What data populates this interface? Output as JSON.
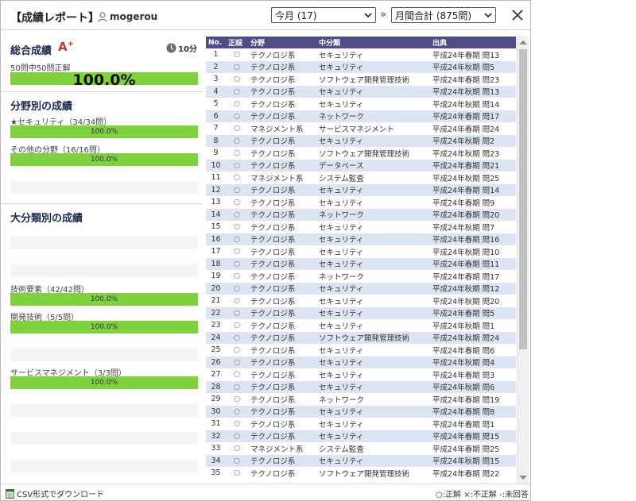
{
  "header": {
    "title": "【成績レポート】",
    "username": "mogerou",
    "period_select": "今月 (17)",
    "arrow": "»",
    "scope_select": "月間合計 (875問)"
  },
  "overall": {
    "title": "総合成績",
    "grade": "A",
    "grade_sup": "+",
    "time": "10分",
    "summary": "50問中50問正解",
    "percent": "100.0%"
  },
  "by_field": {
    "title": "分野別の成績",
    "items": [
      {
        "label": "★セキュリティ（34/34問）",
        "value": "100.0%"
      },
      {
        "label": "その他の分野（16/16問）",
        "value": "100.0%"
      }
    ]
  },
  "by_major": {
    "title": "大分類別の成績",
    "items": [
      {
        "label": "技術要素（42/42問）",
        "value": "100.0%"
      },
      {
        "label": "開発技術（5/5問）",
        "value": "100.0%"
      },
      {
        "label": "サービスマネジメント（3/3問）",
        "value": "100.0%"
      }
    ]
  },
  "table": {
    "headers": [
      "No.",
      "正誤",
      "分野",
      "中分類",
      "出典"
    ],
    "rows": [
      [
        "1",
        "○",
        "テクノロジ系",
        "セキュリティ",
        "平成24年春期 問13"
      ],
      [
        "2",
        "○",
        "テクノロジ系",
        "セキュリティ",
        "平成24年秋期 問5"
      ],
      [
        "3",
        "○",
        "テクノロジ系",
        "ソフトウェア開発管理技術",
        "平成24年春期 問23"
      ],
      [
        "4",
        "○",
        "テクノロジ系",
        "セキュリティ",
        "平成24年秋期 問13"
      ],
      [
        "5",
        "○",
        "テクノロジ系",
        "セキュリティ",
        "平成24年秋期 問14"
      ],
      [
        "6",
        "○",
        "テクノロジ系",
        "ネットワーク",
        "平成24年春期 問17"
      ],
      [
        "7",
        "○",
        "マネジメント系",
        "サービスマネジメント",
        "平成24年春期 問24"
      ],
      [
        "8",
        "○",
        "テクノロジ系",
        "セキュリティ",
        "平成24年秋期 問2"
      ],
      [
        "9",
        "○",
        "テクノロジ系",
        "ソフトウェア開発管理技術",
        "平成24年秋期 問23"
      ],
      [
        "10",
        "○",
        "テクノロジ系",
        "データベース",
        "平成24年春期 問21"
      ],
      [
        "11",
        "○",
        "マネジメント系",
        "システム監査",
        "平成24年秋期 問25"
      ],
      [
        "12",
        "○",
        "テクノロジ系",
        "セキュリティ",
        "平成24年春期 問14"
      ],
      [
        "13",
        "○",
        "テクノロジ系",
        "セキュリティ",
        "平成24年春期 問9"
      ],
      [
        "14",
        "○",
        "テクノロジ系",
        "ネットワーク",
        "平成24年春期 問20"
      ],
      [
        "15",
        "○",
        "テクノロジ系",
        "セキュリティ",
        "平成24年秋期 問7"
      ],
      [
        "16",
        "○",
        "テクノロジ系",
        "セキュリティ",
        "平成24年春期 問16"
      ],
      [
        "17",
        "○",
        "テクノロジ系",
        "セキュリティ",
        "平成24年秋期 問10"
      ],
      [
        "18",
        "○",
        "テクノロジ系",
        "セキュリティ",
        "平成24年春期 問11"
      ],
      [
        "19",
        "○",
        "テクノロジ系",
        "ネットワーク",
        "平成24年春期 問17"
      ],
      [
        "20",
        "○",
        "テクノロジ系",
        "セキュリティ",
        "平成24年秋期 問12"
      ],
      [
        "21",
        "○",
        "テクノロジ系",
        "セキュリティ",
        "平成24年秋期 問20"
      ],
      [
        "22",
        "○",
        "テクノロジ系",
        "セキュリティ",
        "平成24年春期 問5"
      ],
      [
        "23",
        "○",
        "テクノロジ系",
        "セキュリティ",
        "平成24年秋期 問1"
      ],
      [
        "24",
        "○",
        "テクノロジ系",
        "ソフトウェア開発管理技術",
        "平成24年秋期 問24"
      ],
      [
        "25",
        "○",
        "テクノロジ系",
        "セキュリティ",
        "平成24年春期 問6"
      ],
      [
        "26",
        "○",
        "テクノロジ系",
        "セキュリティ",
        "平成24年秋期 問4"
      ],
      [
        "27",
        "○",
        "テクノロジ系",
        "セキュリティ",
        "平成24年春期 問3"
      ],
      [
        "28",
        "○",
        "テクノロジ系",
        "セキュリティ",
        "平成24年秋期 問6"
      ],
      [
        "29",
        "○",
        "テクノロジ系",
        "ネットワーク",
        "平成24年春期 問19"
      ],
      [
        "30",
        "○",
        "テクノロジ系",
        "セキュリティ",
        "平成24年春期 問8"
      ],
      [
        "31",
        "○",
        "テクノロジ系",
        "セキュリティ",
        "平成24年春期 問1"
      ],
      [
        "32",
        "○",
        "テクノロジ系",
        "セキュリティ",
        "平成24年春期 問15"
      ],
      [
        "33",
        "○",
        "マネジメント系",
        "システム監査",
        "平成24年春期 問25"
      ],
      [
        "34",
        "○",
        "テクノロジ系",
        "セキュリティ",
        "平成24年秋期 問15"
      ],
      [
        "35",
        "○",
        "テクノロジ系",
        "ソフトウェア開発管理技術",
        "平成24年春期 問22"
      ]
    ]
  },
  "footer": {
    "csv": "CSV形式でダウンロード",
    "legend": "○:正解 ×:不正解 -:未回答"
  },
  "colors": {
    "bar": "#7ed23e",
    "table_header": "#4e4d86",
    "row_alt": "#dde4f2",
    "grade": "#c0392b"
  }
}
